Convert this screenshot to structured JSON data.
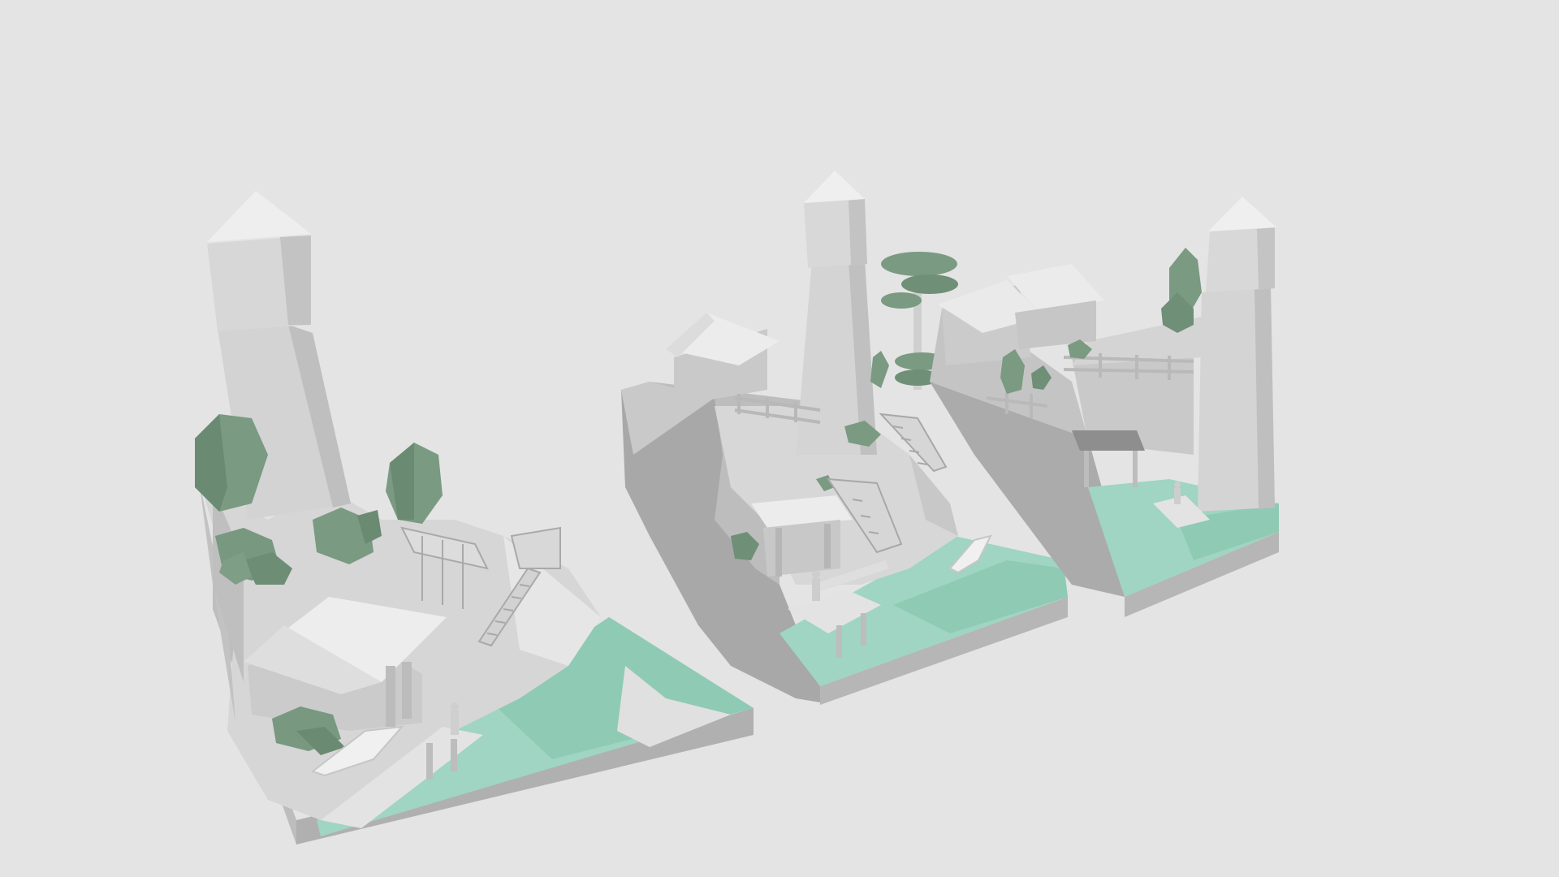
{
  "scene": {
    "background": "#e4e4e4",
    "palette": {
      "wall_light": "#d9d9d9",
      "wall_mid": "#c4c4c4",
      "wall_dark": "#a9a9a9",
      "roof": "#eeeeee",
      "water": "#9fd5c2",
      "water_dark": "#86c4ae",
      "foliage": "#7a9a82",
      "foliage_dark": "#5e7d67",
      "wood": "#cfcfcf"
    },
    "dioramas": [
      {
        "label": "diorama-left",
        "elements": [
          "lighthouse",
          "boathouse",
          "staircase",
          "trees",
          "dock",
          "rowboat",
          "figure",
          "water"
        ]
      },
      {
        "label": "diorama-middle",
        "elements": [
          "lighthouse",
          "house",
          "pine-tree",
          "staircase",
          "hut",
          "dock",
          "rowboat",
          "figures",
          "water"
        ]
      },
      {
        "label": "diorama-right",
        "elements": [
          "lighthouse",
          "house",
          "trees",
          "fence",
          "boat-shelter",
          "dock",
          "figure",
          "water"
        ]
      }
    ]
  }
}
